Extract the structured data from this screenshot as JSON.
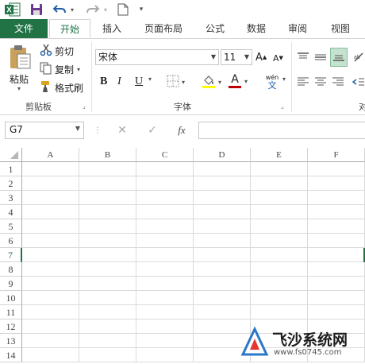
{
  "qat": {
    "excel_icon": "excel-logo-icon",
    "save_icon": "save-icon",
    "undo_icon": "undo-icon",
    "redo_icon": "redo-icon",
    "new_icon": "new-file-icon",
    "customize_icon": "customize-qat-icon"
  },
  "tabs": [
    {
      "label": "文件"
    },
    {
      "label": "开始"
    },
    {
      "label": "插入"
    },
    {
      "label": "页面布局"
    },
    {
      "label": "公式"
    },
    {
      "label": "数据"
    },
    {
      "label": "审阅"
    },
    {
      "label": "视图"
    }
  ],
  "clipboard": {
    "paste_label": "粘贴",
    "cut_label": "剪切",
    "copy_label": "复制",
    "format_painter_label": "格式刷",
    "group_label": "剪贴板"
  },
  "font": {
    "font_name": "宋体",
    "font_size": "11",
    "bold": "B",
    "italic": "I",
    "underline": "U",
    "group_label": "字体",
    "increase_label": "A",
    "decrease_label": "A",
    "wen_label": "wén",
    "wen_char": "文",
    "font_color": "A"
  },
  "alignment": {
    "group_label": "对"
  },
  "formula_bar": {
    "name_box": "G7",
    "fx_label": "fx",
    "formula_value": ""
  },
  "grid": {
    "columns": [
      "A",
      "B",
      "C",
      "D",
      "E",
      "F"
    ],
    "rows": [
      "1",
      "2",
      "3",
      "4",
      "5",
      "6",
      "7",
      "8",
      "9",
      "10",
      "11",
      "12",
      "13",
      "14"
    ],
    "active_row": "7"
  },
  "watermark": {
    "title": "飞沙系统网",
    "url": "www.fs0745.com"
  },
  "colors": {
    "excel_green": "#217346",
    "font_color_bar": "#c00000",
    "highlight_color": "#ffff00"
  }
}
